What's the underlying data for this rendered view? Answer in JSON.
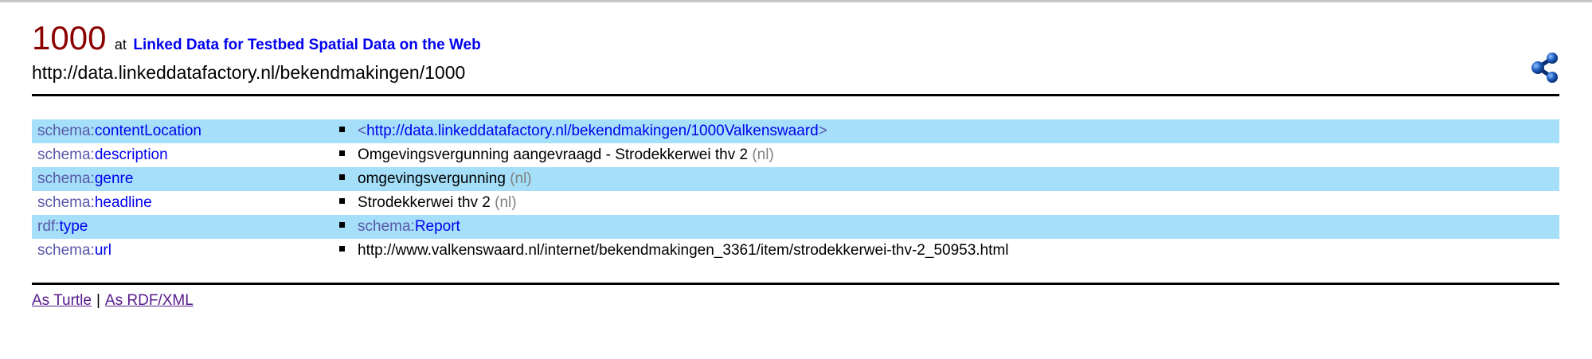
{
  "header": {
    "resource_id": "1000",
    "at_label": "at",
    "dataset_title": "Linked Data for Testbed Spatial Data on the Web",
    "resource_uri": "http://data.linkeddatafactory.nl/bekendmakingen/1000",
    "share_icon": "share-icon"
  },
  "properties": [
    {
      "prefix": "schema:",
      "local": "contentLocation",
      "object_kind": "uri",
      "open": "<",
      "value": "http://data.linkeddatafactory.nl/bekendmakingen/1000Valkenswaard",
      "close": ">"
    },
    {
      "prefix": "schema:",
      "local": "description",
      "object_kind": "literal",
      "value": "Omgevingsvergunning aangevraagd - Strodekkerwei thv 2",
      "lang": "(nl)"
    },
    {
      "prefix": "schema:",
      "local": "genre",
      "object_kind": "literal",
      "value": "omgevingsvergunning",
      "lang": "(nl)"
    },
    {
      "prefix": "schema:",
      "local": "headline",
      "object_kind": "literal",
      "value": "Strodekkerwei thv 2",
      "lang": "(nl)"
    },
    {
      "prefix": "rdf:",
      "local": "type",
      "object_kind": "qname",
      "obj_prefix": "schema:",
      "obj_local": "Report"
    },
    {
      "prefix": "schema:",
      "local": "url",
      "object_kind": "plain",
      "value": "http://www.valkenswaard.nl/internet/bekendmakingen_3361/item/strodekkerwei-thv-2_50953.html"
    }
  ],
  "footer": {
    "turtle_label": "As Turtle",
    "separator": "|",
    "rdfxml_label": "As RDF/XML"
  },
  "colors": {
    "title_number": "#8b0000",
    "row_highlight": "#a5dffa",
    "link": "#0000ee",
    "prefix": "#5a58a8",
    "lang_tag": "#808080",
    "visited_link": "#551a8b",
    "share_icon": "#1f5fbf"
  }
}
